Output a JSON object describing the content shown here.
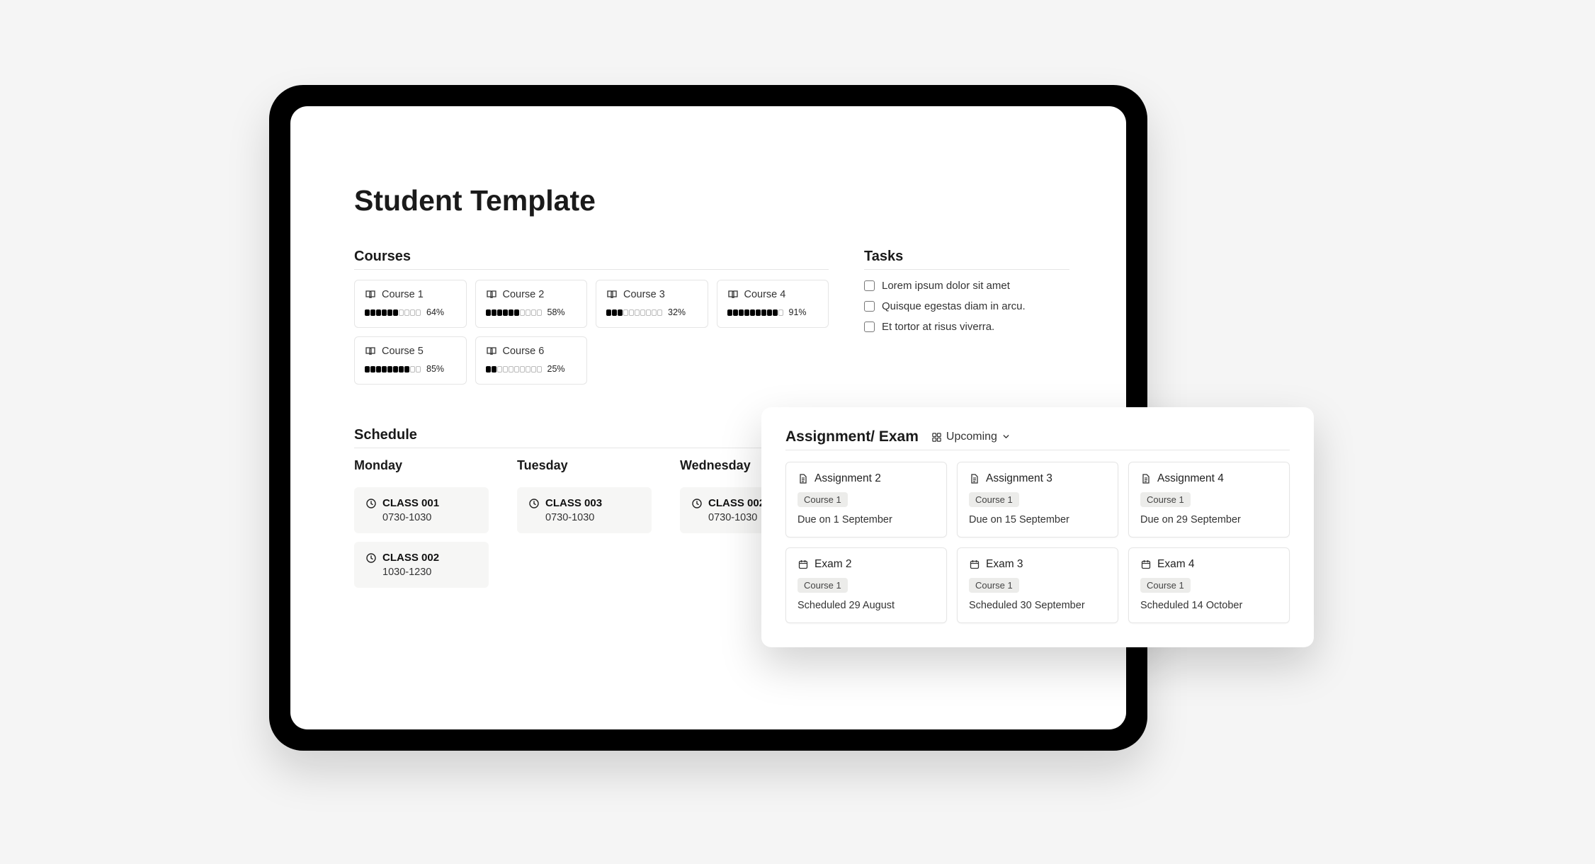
{
  "page_title": "Student Template",
  "courses": {
    "heading": "Courses",
    "items": [
      {
        "name": "Course 1",
        "percent": "64%",
        "filled": 6
      },
      {
        "name": "Course 2",
        "percent": "58%",
        "filled": 6
      },
      {
        "name": "Course 3",
        "percent": "32%",
        "filled": 3
      },
      {
        "name": "Course 4",
        "percent": "91%",
        "filled": 9
      },
      {
        "name": "Course 5",
        "percent": "85%",
        "filled": 8
      },
      {
        "name": "Course 6",
        "percent": "25%",
        "filled": 2
      }
    ]
  },
  "tasks": {
    "heading": "Tasks",
    "items": [
      "Lorem ipsum dolor sit amet",
      "Quisque egestas diam in arcu.",
      "Et tortor at risus viverra."
    ]
  },
  "schedule": {
    "heading": "Schedule",
    "days": [
      {
        "name": "Monday",
        "classes": [
          {
            "name": "CLASS 001",
            "time": "0730-1030"
          },
          {
            "name": "CLASS 002",
            "time": "1030-1230"
          }
        ]
      },
      {
        "name": "Tuesday",
        "classes": [
          {
            "name": "CLASS 003",
            "time": "0730-1030"
          }
        ]
      },
      {
        "name": "Wednesday",
        "classes": [
          {
            "name": "CLASS 002",
            "time": "0730-1030"
          }
        ]
      }
    ]
  },
  "overlay": {
    "title": "Assignment/ Exam",
    "view": "Upcoming",
    "items": [
      {
        "icon": "file",
        "name": "Assignment 2",
        "course": "Course 1",
        "meta": "Due on 1 September"
      },
      {
        "icon": "file",
        "name": "Assignment 3",
        "course": "Course 1",
        "meta": "Due on 15 September"
      },
      {
        "icon": "file",
        "name": "Assignment 4",
        "course": "Course 1",
        "meta": "Due on 29 September"
      },
      {
        "icon": "calendar",
        "name": "Exam 2",
        "course": "Course 1",
        "meta": "Scheduled 29 August"
      },
      {
        "icon": "calendar",
        "name": "Exam 3",
        "course": "Course 1",
        "meta": "Scheduled 30 September"
      },
      {
        "icon": "calendar",
        "name": "Exam 4",
        "course": "Course 1",
        "meta": "Scheduled 14 October"
      }
    ]
  }
}
